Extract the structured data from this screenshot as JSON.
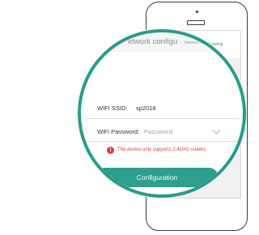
{
  "phone_screen": {
    "title": "Network configuring"
  },
  "magnified": {
    "header_title": "etwork configu",
    "ssid_label": "WIFI SSID:",
    "ssid_value": "sp2018",
    "password_label": "WiFi Password:",
    "password_placeholder": "Password",
    "warning_icon": "!",
    "warning_text": "The device only supports 2.4GHz routers",
    "configure_button": "Configuration"
  },
  "colors": {
    "accent": "#2e9e8d",
    "warning": "#e23c3c"
  },
  "icons": [
    "phone-speaker-icon",
    "home-button-icon",
    "chevron-down-icon",
    "warning-icon"
  ]
}
